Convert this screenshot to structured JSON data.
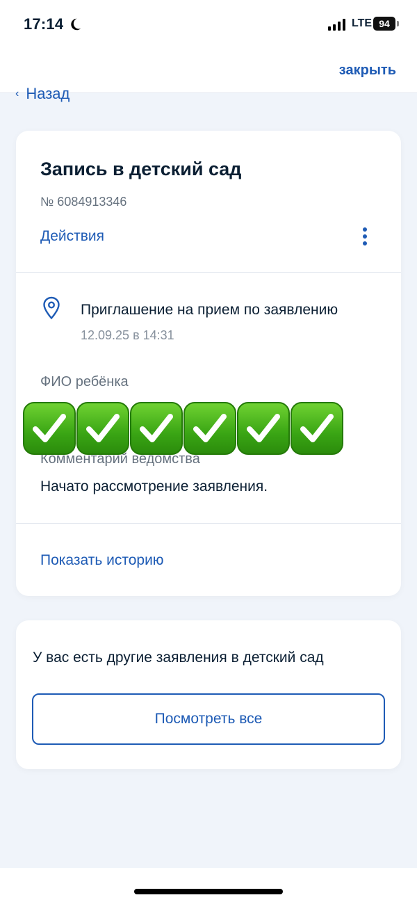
{
  "status_bar": {
    "time": "17:14",
    "network": "LTE",
    "battery": "94",
    "icons": [
      "moon-icon",
      "signal-icon",
      "battery-icon"
    ]
  },
  "header": {
    "close_label": "закрыть",
    "back_label": "Назад"
  },
  "application_card": {
    "title": "Запись в детский сад",
    "number": "№ 6084913346",
    "actions_label": "Действия",
    "event": {
      "title": "Приглашение на прием по заявлению",
      "date": "12.09.25 в 14:31"
    },
    "child_name_label": "ФИО ребёнка",
    "comment_label": "Комментарий ведомства",
    "comment_text": "Начато рассмотрение заявления.",
    "history_link": "Показать историю"
  },
  "other_applications": {
    "text": "У вас есть другие заявления в детский сад",
    "button_label": "Посмотреть все"
  },
  "colors": {
    "accent": "#1e5bb5",
    "background": "#f0f4fa",
    "check_green": "#3aa514"
  }
}
